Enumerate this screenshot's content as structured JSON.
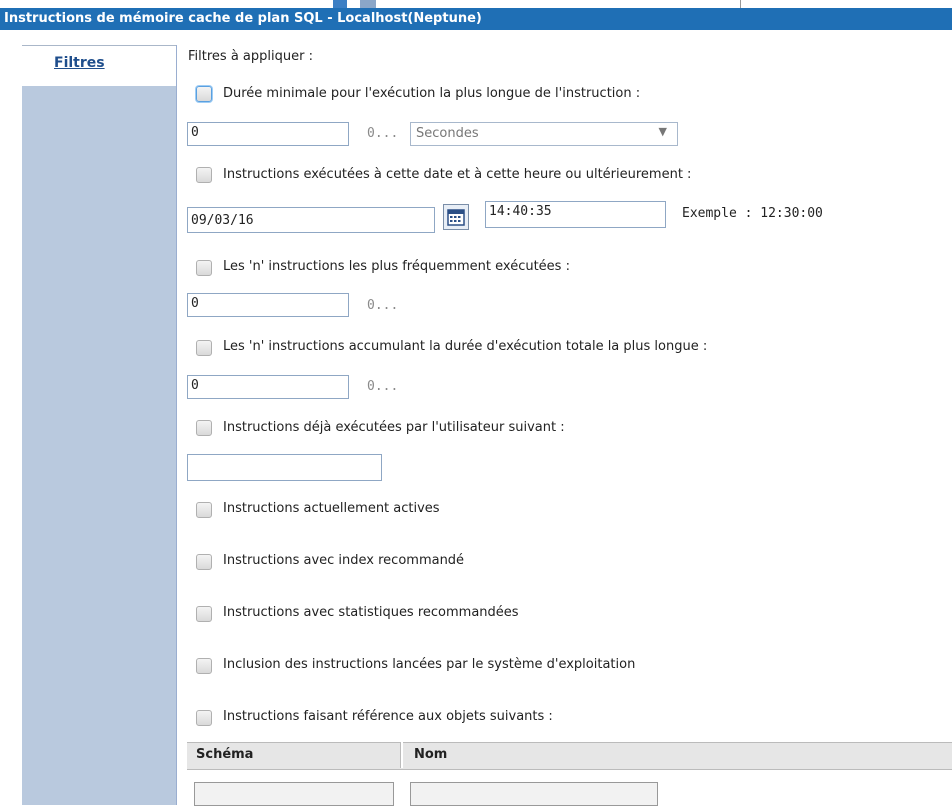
{
  "window": {
    "title": "Instructions de mémoire cache de plan SQL - Localhost(Neptune)"
  },
  "sidebar": {
    "tab_label": "Filtres"
  },
  "filters": {
    "heading": "Filtres à appliquer :",
    "min_duration": {
      "label": "Durée minimale pour l'exécution la plus longue de l'instruction :",
      "value": "0",
      "hint": "0...",
      "unit": "Secondes"
    },
    "after_date": {
      "label": "Instructions exécutées à cette date et à cette heure ou ultérieurement :",
      "date": "09/03/16",
      "time": "14:40:35",
      "example": "Exemple : 12:30:00"
    },
    "most_frequent": {
      "label": "Les 'n' instructions les plus fréquemment exécutées :",
      "value": "0",
      "hint": "0..."
    },
    "longest_total": {
      "label": "Les 'n' instructions accumulant la durée d'exécution totale la plus longue :",
      "value": "0",
      "hint": "0..."
    },
    "by_user": {
      "label": "Instructions déjà exécutées par l'utilisateur suivant :",
      "value": ""
    },
    "active": {
      "label": "Instructions actuellement actives"
    },
    "index_rec": {
      "label": "Instructions avec index recommandé"
    },
    "stats_rec": {
      "label": "Instructions avec statistiques recommandées"
    },
    "os_included": {
      "label": "Inclusion des instructions lancées par le système d'exploitation"
    },
    "objects_ref": {
      "label": "Instructions faisant référence aux objets suivants :"
    },
    "objects_table": {
      "columns": [
        "Schéma",
        "Nom"
      ]
    }
  },
  "icons": {
    "calendar": "calendar-icon",
    "dropdown": "chevron-down-icon"
  },
  "colors": {
    "titlebar": "#1f6fb5",
    "sidebar": "#b9c9de",
    "tab_text": "#1f4e8c"
  }
}
